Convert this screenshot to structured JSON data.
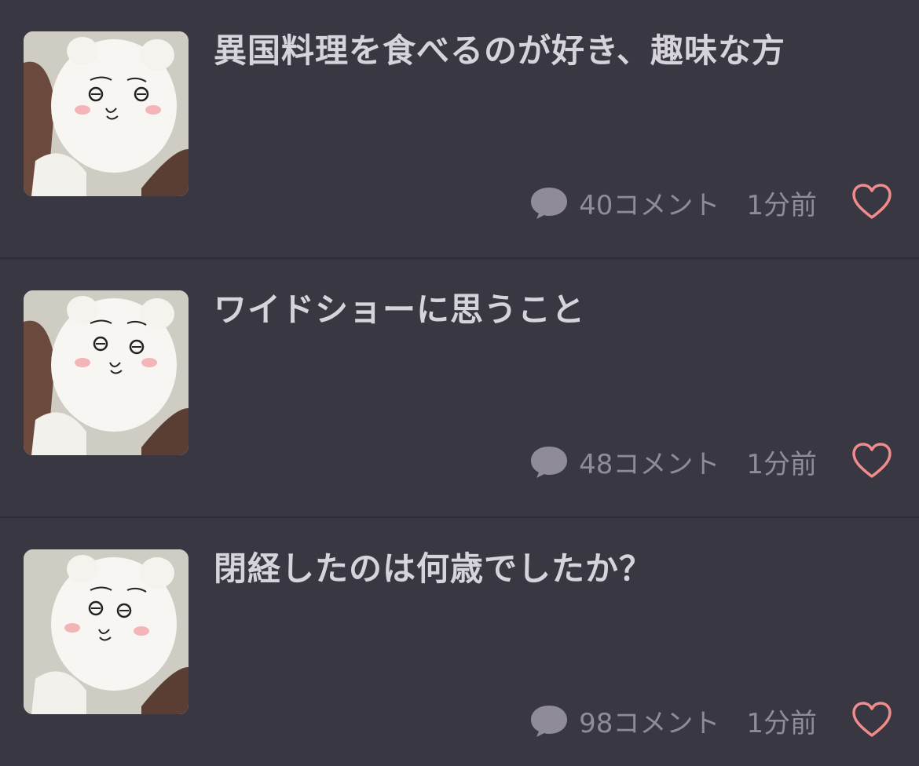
{
  "topics": [
    {
      "title": "異国料理を食べるのが好き、趣味な方",
      "comments": "40コメント",
      "time": "1分前"
    },
    {
      "title": "ワイドショーに思うこと",
      "comments": "48コメント",
      "time": "1分前"
    },
    {
      "title": "閉経したのは何歳でしたか？",
      "comments": "98コメント",
      "time": "1分前"
    }
  ],
  "colors": {
    "background": "#393742",
    "title": "#d6d4da",
    "meta": "#8f8c97",
    "heart": "#f28c8c"
  },
  "icons": {
    "comment": "speech-bubble-icon",
    "favorite": "heart-outline-icon",
    "thumbnail": "plush-character-avatar"
  }
}
